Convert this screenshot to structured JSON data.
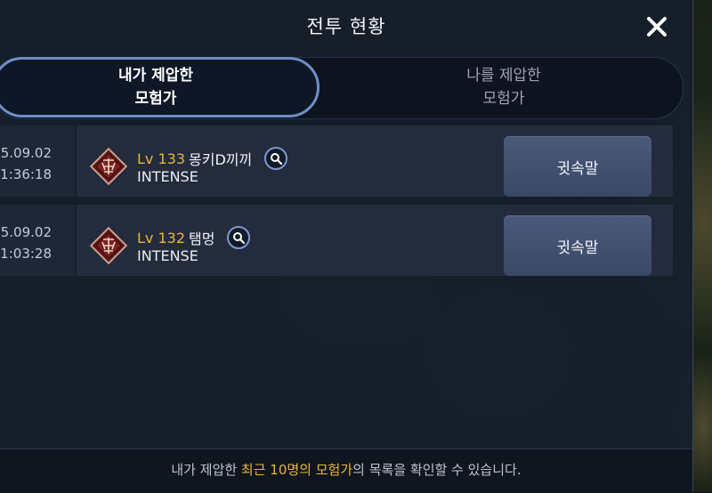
{
  "header": {
    "title": "전투 현황",
    "close_icon": "close-icon"
  },
  "tabs": [
    {
      "line1": "내가 제압한",
      "line2": "모험가",
      "active": true
    },
    {
      "line1": "나를 제압한",
      "line2": "모험가",
      "active": false
    }
  ],
  "rows": [
    {
      "date": "5.09.02",
      "time": "1:36:18",
      "level": "Lv 133",
      "name": "몽키D끼끼",
      "mode": "INTENSE",
      "whisper_label": "귓속말"
    },
    {
      "date": "5.09.02",
      "time": "1:03:28",
      "level": "Lv 132",
      "name": "탬멍",
      "mode": "INTENSE",
      "whisper_label": "귓속말"
    }
  ],
  "footer": {
    "prefix": "내가 제압한 ",
    "highlight": "최근 10명의 모험가",
    "suffix": "의 목록을 확인할 수 있습니다."
  },
  "colors": {
    "accent_gold": "#e9b43c",
    "tab_border": "#6d8fc6",
    "button_bg": "#4b5a7a"
  }
}
